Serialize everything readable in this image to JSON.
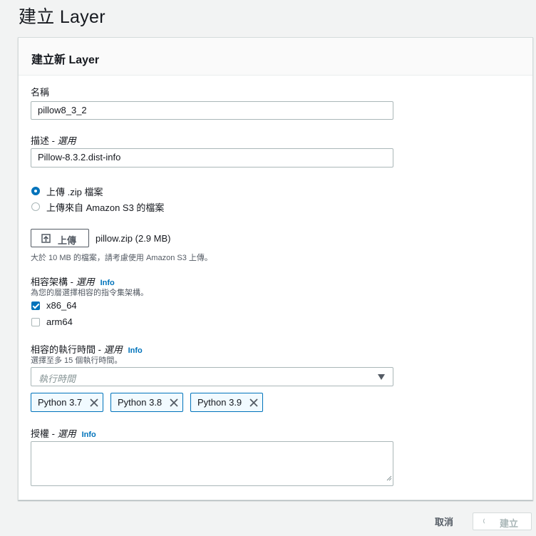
{
  "page": {
    "title": "建立 Layer"
  },
  "panel": {
    "title": "建立新 Layer"
  },
  "name_field": {
    "label": "名稱",
    "value": "pillow8_3_2"
  },
  "description_field": {
    "label": "描述 - ",
    "optional": "選用",
    "value": "Pillow-8.3.2.dist-info"
  },
  "source": {
    "options": [
      {
        "label": "上傳 .zip 檔案",
        "selected": true
      },
      {
        "label": "上傳來自 Amazon S3 的檔案",
        "selected": false
      }
    ]
  },
  "upload": {
    "button_label": "上傳",
    "file": "pillow.zip (2.9 MB)",
    "hint": "大於 10 MB 的檔案，請考慮使用 Amazon S3 上傳。"
  },
  "architectures": {
    "label": "相容架構 - ",
    "optional": "選用",
    "info": "Info",
    "description": "為您的層選擇相容的指令集架構。",
    "options": [
      {
        "label": "x86_64",
        "checked": true
      },
      {
        "label": "arm64",
        "checked": false
      }
    ]
  },
  "runtimes": {
    "label": "相容的執行時間 - ",
    "optional": "選用",
    "info": "Info",
    "description": "選擇至多 15 個執行時間。",
    "placeholder": "執行時間",
    "tokens": [
      "Python 3.7",
      "Python 3.8",
      "Python 3.9"
    ]
  },
  "license": {
    "label": "授權 - ",
    "optional": "選用",
    "info": "Info",
    "value": ""
  },
  "footer": {
    "cancel_label": "取消",
    "create_label": "建立"
  },
  "colors": {
    "accent": "#0073bb",
    "background": "#f2f3f3",
    "border": "#aab7b8"
  }
}
